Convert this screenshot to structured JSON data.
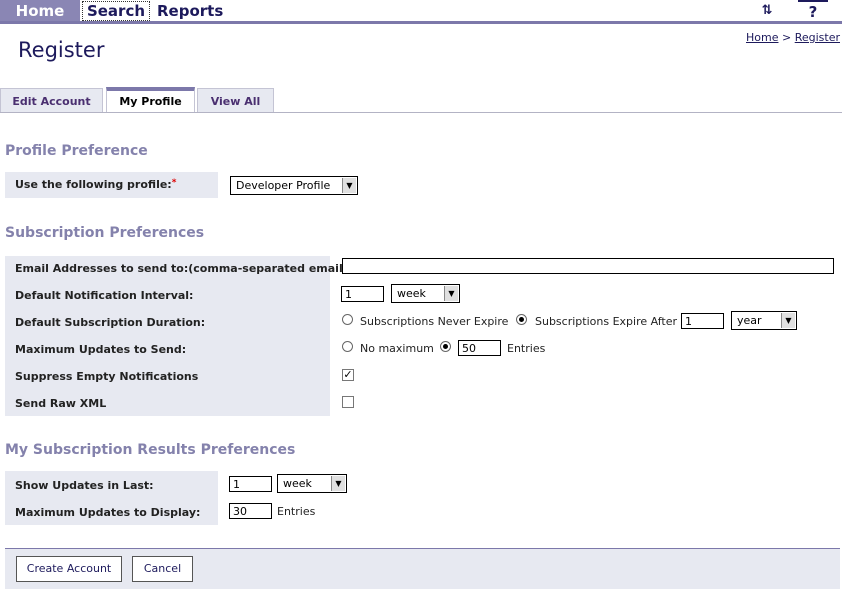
{
  "nav": {
    "home": "Home",
    "search": "Search",
    "reports": "Reports",
    "sync_icon": "sync-icon",
    "help": "?"
  },
  "page": {
    "title": "Register",
    "breadcrumb": {
      "home": "Home",
      "sep": ">",
      "current": "Register"
    }
  },
  "tabs": [
    "Edit Account",
    "My Profile",
    "View All"
  ],
  "active_tab": "My Profile",
  "profile_pref": {
    "title": "Profile Preference",
    "profile_label": "Use the following profile:",
    "required_mark": "*",
    "profile_value": "Developer Profile"
  },
  "subscription_prefs": {
    "title": "Subscription Preferences",
    "email_label": "Email Addresses to send to:(comma-separated emails)",
    "email_value": "",
    "interval_label": "Default Notification Interval:",
    "interval_value": "1",
    "interval_unit": "week",
    "duration_label": "Default Subscription Duration:",
    "duration_opt1": "Subscriptions Never Expire",
    "duration_opt2": "Subscriptions Expire After",
    "duration_value": "1",
    "duration_unit": "year",
    "max_updates_label": "Maximum Updates to Send:",
    "max_opt1": "No maximum",
    "max_value": "50",
    "max_suffix": "Entries",
    "suppress_label": "Suppress Empty Notifications",
    "suppress_checked": true,
    "raw_xml_label": "Send Raw XML",
    "raw_xml_checked": false
  },
  "results_prefs": {
    "title": "My Subscription Results Preferences",
    "show_label": "Show Updates in Last:",
    "show_value": "1",
    "show_unit": "week",
    "max_display_label": "Maximum Updates to Display:",
    "max_display_value": "30",
    "max_display_suffix": "Entries"
  },
  "buttons": {
    "create": "Create Account",
    "cancel": "Cancel"
  },
  "colors": {
    "accent": "#7c78aa",
    "nav_home": "#8a86b4",
    "label_bg": "#e7e9f1",
    "section_title": "#8482ac",
    "dark_text": "#1d1a5c"
  }
}
